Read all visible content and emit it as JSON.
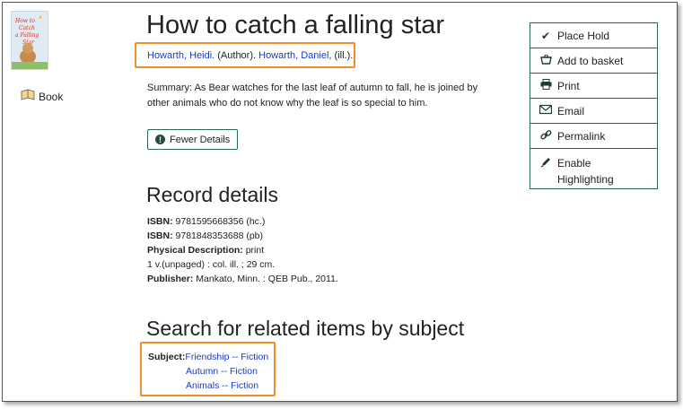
{
  "record": {
    "title": "How to catch a falling star",
    "format_label": "Book",
    "authors": [
      {
        "name": "Howarth, Heidi.",
        "role": "(Author)."
      },
      {
        "name": "Howarth, Daniel,",
        "role": "(ill.)."
      }
    ],
    "summary": "Summary: As Bear watches for the last leaf of autumn to fall, he is joined by other animals who do not know why the leaf is so special to him.",
    "fewer_details_label": "Fewer Details"
  },
  "details": {
    "heading": "Record details",
    "isbn_label": "ISBN:",
    "isbn1": "9781595668356 (hc.)",
    "isbn2": "9781848353688 (pb)",
    "physical_label": "Physical Description:",
    "physical_value": "print",
    "physical_extent": "1 v.(unpaged) : col. ill. ; 29 cm.",
    "publisher_label": "Publisher:",
    "publisher_value": "Mankato, Minn. : QEB Pub., 2011."
  },
  "subjects": {
    "heading": "Search for related items by subject",
    "label": "Subject:",
    "items": [
      "Friendship -- Fiction",
      "Autumn -- Fiction",
      "Animals -- Fiction"
    ]
  },
  "actions": {
    "place_hold": "Place Hold",
    "add_to_basket": "Add to basket",
    "print": "Print",
    "email": "Email",
    "permalink": "Permalink",
    "enable_highlighting": "Enable Highlighting"
  },
  "icons": {
    "place_hold": "check-icon",
    "add_to_basket": "basket-icon",
    "print": "print-icon",
    "email": "email-icon",
    "permalink": "link-icon",
    "enable_highlighting": "pencil-icon",
    "format": "book-icon",
    "fewer_details": "info-icon"
  },
  "colors": {
    "highlight_box": "#f28c28",
    "button_border": "#2a6b4f",
    "link": "#1a3cc2"
  }
}
